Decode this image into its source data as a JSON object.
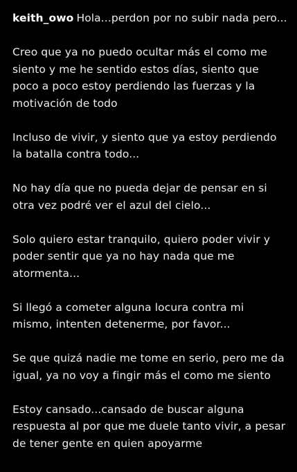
{
  "comment": {
    "username": "keith_owo",
    "paragraphs": [
      "Hola...perdon por no subir nada pero...",
      "Creo que ya no puedo ocultar más el como me siento y me he sentido estos días, siento que poco a poco estoy perdiendo las fuerzas y la motivación de todo",
      "Incluso de vivir, y siento que ya estoy perdiendo la batalla contra todo...",
      "No hay día que no pueda dejar de pensar en si otra vez podré ver el azul del cielo...",
      "Solo quiero estar tranquilo, quiero poder vivir y poder sentir que ya no hay nada que me atormenta...",
      "Si llegó a cometer alguna locura contra mi mismo, intenten detenerme, por favor...",
      "Se que quizá nadie me tome en serio, pero me da igual, ya no voy a fingir más el como me siento",
      "Estoy cansado...cansado de buscar alguna respuesta al por que me duele tanto vivir, a pesar de tener gente en quien apoyarme"
    ]
  }
}
